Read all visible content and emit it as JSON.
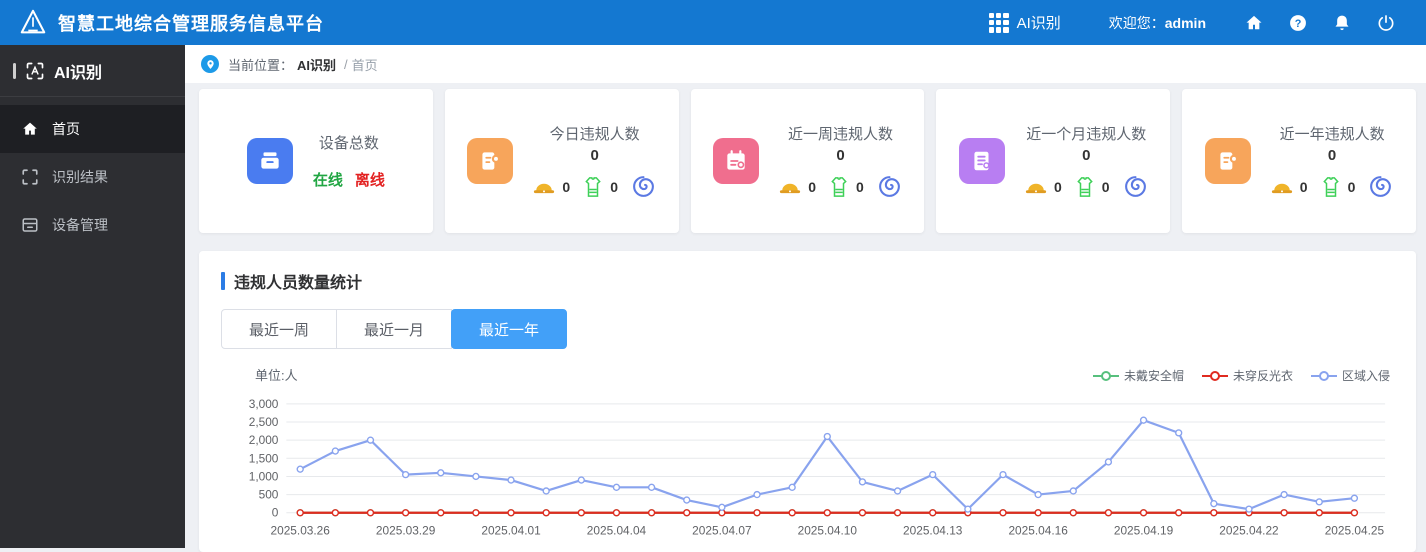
{
  "header": {
    "title": "智慧工地综合管理服务信息平台",
    "app_switcher": "AI识别",
    "welcome_label": "欢迎您：",
    "username": "admin"
  },
  "sidebar": {
    "title": "AI识别",
    "items": [
      {
        "label": "首页",
        "active": true
      },
      {
        "label": "识别结果",
        "active": false
      },
      {
        "label": "设备管理",
        "active": false
      }
    ]
  },
  "breadcrumb": {
    "prefix": "当前位置：",
    "section": "AI识别",
    "separator": "/",
    "current": "首页"
  },
  "stat_cards": [
    {
      "title": "设备总数",
      "online_label": "在线",
      "offline_label": "离线",
      "icon_color": "#4a7cf0"
    },
    {
      "title": "今日违规人数",
      "total": "0",
      "helmet_count": "0",
      "vest_count": "0",
      "icon_color": "#f7a55b"
    },
    {
      "title": "近一周违规人数",
      "total": "0",
      "helmet_count": "0",
      "vest_count": "0",
      "icon_color": "#f06e8e"
    },
    {
      "title": "近一个月违规人数",
      "total": "0",
      "helmet_count": "0",
      "vest_count": "0",
      "icon_color": "#b87ef2"
    },
    {
      "title": "近一年违规人数",
      "total": "0",
      "helmet_count": "0",
      "vest_count": "0",
      "icon_color": "#f7a55b"
    }
  ],
  "chart_section": {
    "title": "违规人员数量统计",
    "tabs": [
      {
        "label": "最近一周",
        "active": false
      },
      {
        "label": "最近一月",
        "active": false
      },
      {
        "label": "最近一年",
        "active": true
      }
    ],
    "unit_label": "单位:人"
  },
  "colors": {
    "header_bg": "#1478d1",
    "tab_active": "#42a0f8",
    "online": "#21a643",
    "offline": "#e32222",
    "accent": "#2b7ce5"
  },
  "chart_data": {
    "type": "line",
    "title": "违规人员数量统计",
    "ylabel": "单位:人",
    "ylim": [
      0,
      3000
    ],
    "ytick_step": 500,
    "grid": true,
    "legend_position": "top-right",
    "x": [
      "2025.03.26",
      "2025.03.27",
      "2025.03.28",
      "2025.03.29",
      "2025.03.30",
      "2025.03.31",
      "2025.04.01",
      "2025.04.02",
      "2025.04.03",
      "2025.04.04",
      "2025.04.05",
      "2025.04.06",
      "2025.04.07",
      "2025.04.08",
      "2025.04.09",
      "2025.04.10",
      "2025.04.11",
      "2025.04.12",
      "2025.04.13",
      "2025.04.14",
      "2025.04.15",
      "2025.04.16",
      "2025.04.17",
      "2025.04.18",
      "2025.04.19",
      "2025.04.20",
      "2025.04.21",
      "2025.04.22",
      "2025.04.23",
      "2025.04.24",
      "2025.04.25"
    ],
    "x_tick_labels": [
      "2025.03.26",
      "2025.03.29",
      "2025.04.01",
      "2025.04.04",
      "2025.04.07",
      "2025.04.10",
      "2025.04.13",
      "2025.04.16",
      "2025.04.19",
      "2025.04.22",
      "2025.04.25"
    ],
    "series": [
      {
        "name": "未戴安全帽",
        "color": "#57c07d",
        "values": [
          0,
          0,
          0,
          0,
          0,
          0,
          0,
          0,
          0,
          0,
          0,
          0,
          0,
          0,
          0,
          0,
          0,
          0,
          0,
          0,
          0,
          0,
          0,
          0,
          0,
          0,
          0,
          0,
          0,
          0,
          0
        ]
      },
      {
        "name": "未穿反光衣",
        "color": "#e02b20",
        "values": [
          0,
          0,
          0,
          0,
          0,
          0,
          0,
          0,
          0,
          0,
          0,
          0,
          0,
          0,
          0,
          0,
          0,
          0,
          0,
          0,
          0,
          0,
          0,
          0,
          0,
          0,
          0,
          0,
          0,
          0,
          0
        ]
      },
      {
        "name": "区域入侵",
        "color": "#89a3ee",
        "values": [
          1200,
          1700,
          2000,
          1050,
          1100,
          1000,
          900,
          600,
          900,
          700,
          700,
          350,
          150,
          500,
          700,
          2100,
          850,
          600,
          1050,
          100,
          1050,
          500,
          600,
          1400,
          2550,
          2200,
          250,
          100,
          500,
          300,
          400
        ]
      }
    ]
  }
}
